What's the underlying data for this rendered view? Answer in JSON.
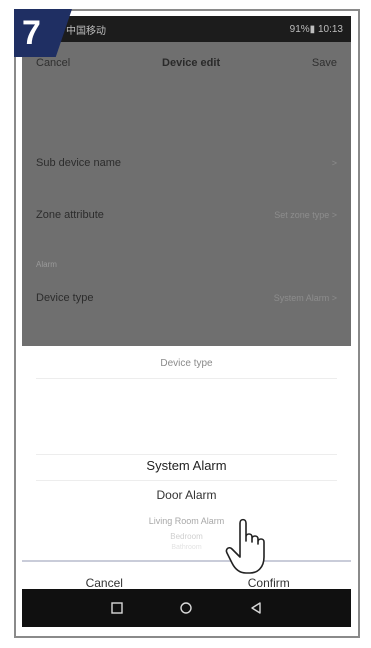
{
  "step": {
    "number": "7"
  },
  "status_bar": {
    "left": "中国移动",
    "right": "91%▮ 10:13"
  },
  "header": {
    "cancel": "Cancel",
    "title": "Device edit",
    "save": "Save"
  },
  "form": {
    "sub_device_name_label": "Sub device name",
    "sub_device_name_value": ">",
    "zone_attribute_label": "Zone attribute",
    "zone_attribute_value": "Set zone type >",
    "section_label": "Alarm",
    "device_type_label": "Device type",
    "device_type_value": "System Alarm >"
  },
  "picker": {
    "title": "Device type",
    "options": [
      "System Alarm",
      "Door Alarm",
      "Living Room Alarm",
      "Bedroom",
      "Bathroom"
    ],
    "selected": "System Alarm",
    "cancel": "Cancel",
    "confirm": "Confirm"
  },
  "nav_bar": {
    "icons": [
      "square-icon",
      "circle-icon",
      "triangle-back-icon"
    ]
  },
  "colors": {
    "overlay": "#6f6f6f",
    "badge": "#1f2f63",
    "nav": "#101010"
  }
}
